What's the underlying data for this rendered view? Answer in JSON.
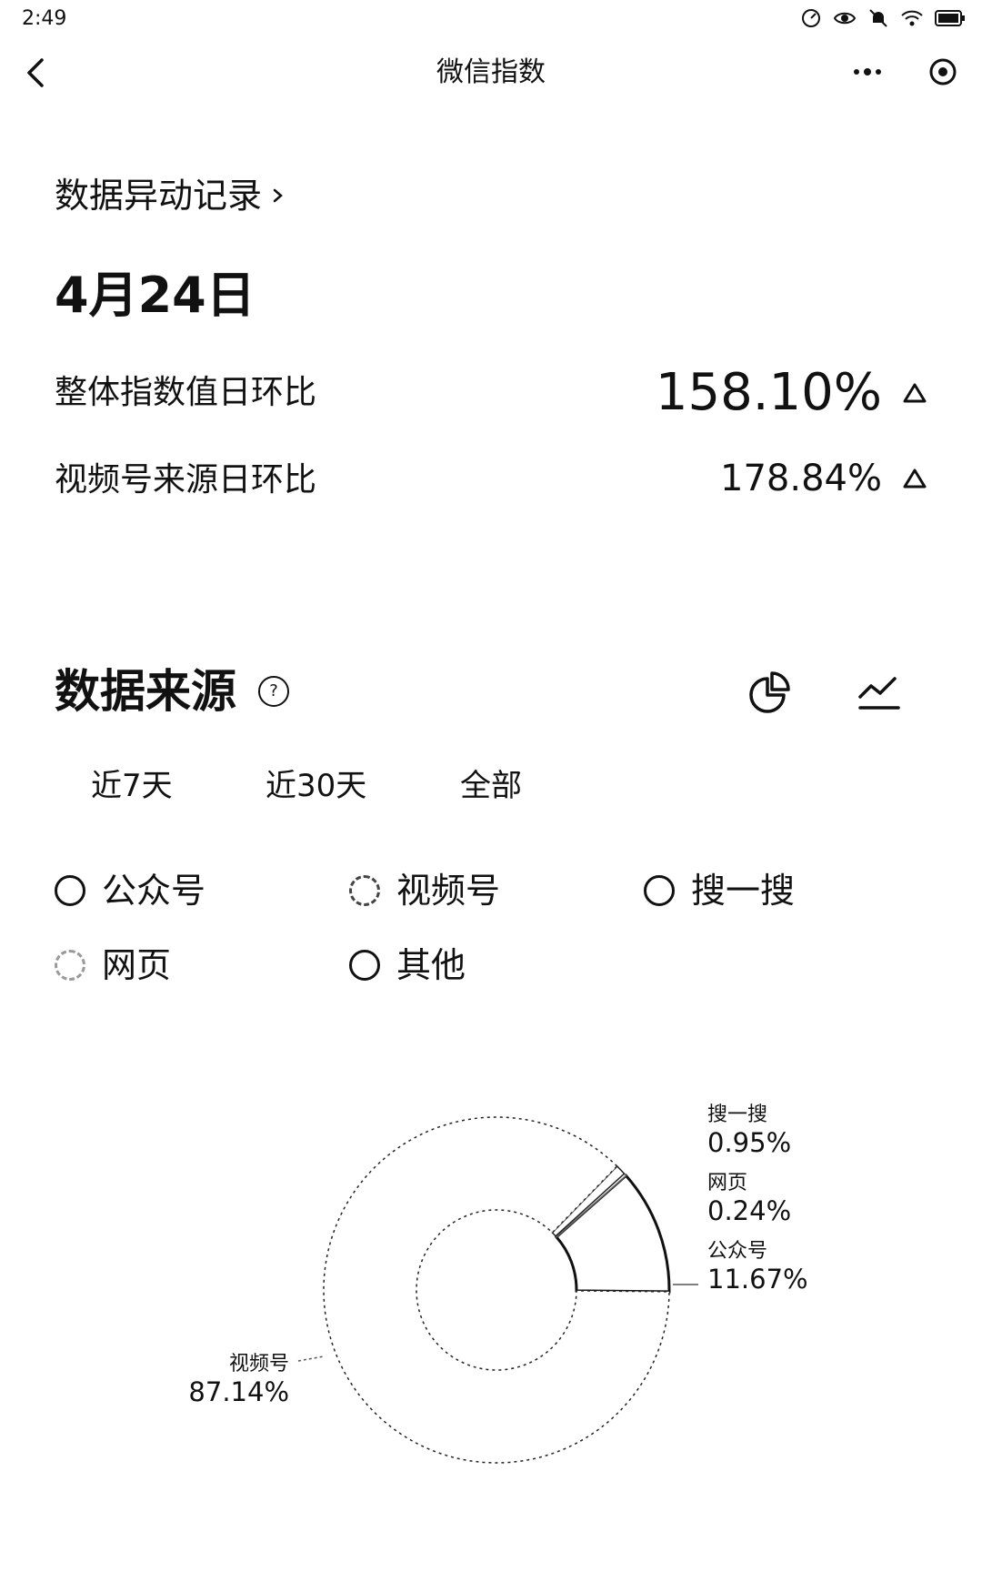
{
  "status_bar": {
    "time": "2:49"
  },
  "nav": {
    "title": "微信指数"
  },
  "anomaly": {
    "link_label": "数据异动记录",
    "date": "4月24日",
    "metrics": [
      {
        "label": "整体指数值日环比",
        "value": "158.10%",
        "trend": "up"
      },
      {
        "label": "视频号来源日环比",
        "value": "178.84%",
        "trend": "up"
      }
    ]
  },
  "sources": {
    "title": "数据来源",
    "help_glyph": "?",
    "tabs": [
      "近7天",
      "近30天",
      "全部"
    ],
    "legend": [
      "公众号",
      "视频号",
      "搜一搜",
      "网页",
      "其他"
    ]
  },
  "chart_data": {
    "type": "pie",
    "categories": [
      "视频号",
      "公众号",
      "网页",
      "搜一搜"
    ],
    "values": [
      87.14,
      11.67,
      0.24,
      0.95
    ],
    "labels": [
      "87.14%",
      "11.67%",
      "0.24%",
      "0.95%"
    ]
  }
}
